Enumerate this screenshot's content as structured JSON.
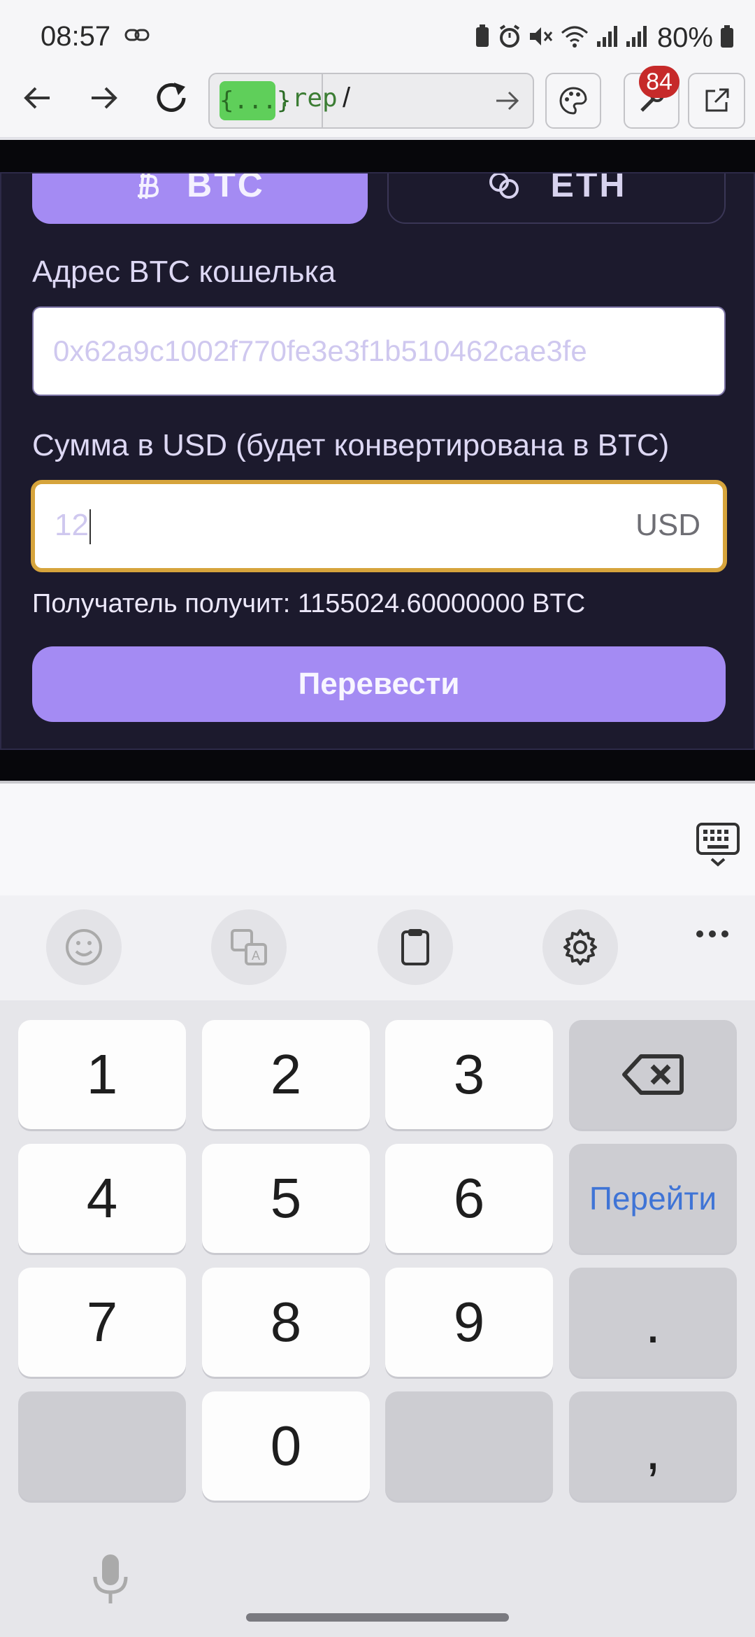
{
  "status_bar": {
    "time": "08:57",
    "battery": "80%"
  },
  "browser": {
    "favicon_text": "{...}",
    "url_host": ".rep",
    "url_path": "/",
    "badge_count": "84"
  },
  "wallet": {
    "tabs": [
      "BTC",
      "ETH"
    ],
    "address_label": "Адрес BTC кошелька",
    "address_placeholder": "0x62a9c1002f770fe3e3f1b510462cae3fe",
    "amount_label": "Сумма в USD (будет конвертирована в BTC)",
    "amount_value": "12",
    "amount_suffix": "USD",
    "receiver_text": "Получатель получит: 1155024.60000000 BTC",
    "transfer_button": "Перевести"
  },
  "keyboard": {
    "keys": [
      "1",
      "2",
      "3",
      "4",
      "5",
      "6",
      "7",
      "8",
      "9",
      "0",
      ".",
      ","
    ],
    "go_label": "Перейти"
  },
  "colors": {
    "accent": "#a48bf3",
    "card_bg": "#1c1a2d",
    "focus_border": "#d6a43c",
    "keyboard_go": "#3f74d6"
  }
}
